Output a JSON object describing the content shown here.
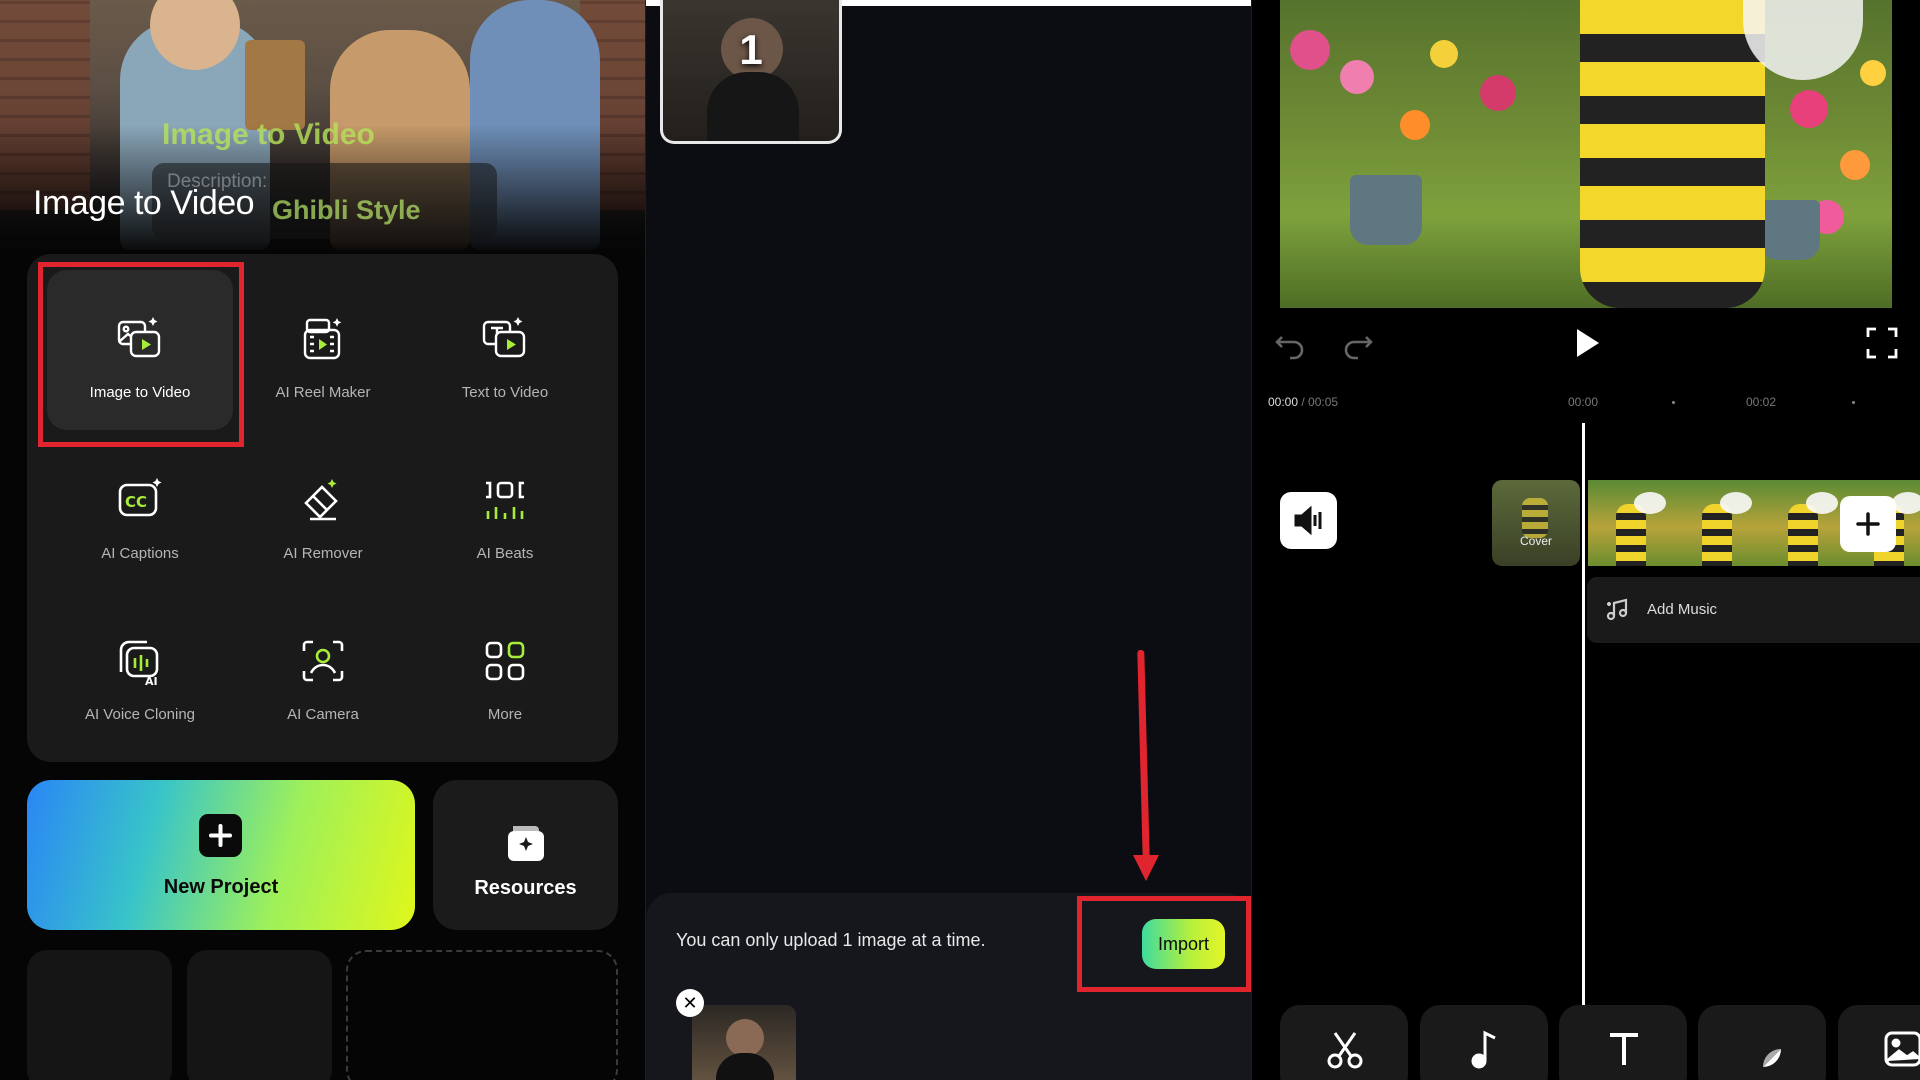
{
  "panel1": {
    "hero": {
      "overlay_title": "Image to Video",
      "overlay_description_label": "Description:",
      "overlay_style": "Ghibli Style",
      "title": "Image to Video"
    },
    "tools": [
      {
        "label": "Image to Video",
        "icon": "image-to-video-icon"
      },
      {
        "label": "AI Reel Maker",
        "icon": "reel-maker-icon"
      },
      {
        "label": "Text to Video",
        "icon": "text-to-video-icon"
      },
      {
        "label": "AI Captions",
        "icon": "captions-icon"
      },
      {
        "label": "AI Remover",
        "icon": "eraser-icon"
      },
      {
        "label": "AI Beats",
        "icon": "beats-icon"
      },
      {
        "label": "AI Voice Cloning",
        "icon": "voice-cloning-icon"
      },
      {
        "label": "AI Camera",
        "icon": "camera-person-icon"
      },
      {
        "label": "More",
        "icon": "grid-icon"
      }
    ],
    "new_project_label": "New Project",
    "resources_label": "Resources"
  },
  "panel2": {
    "thumb_number": "1",
    "upload_notice": "You can only upload 1 image at a time.",
    "import_label": "Import",
    "close_glyph": "✕"
  },
  "panel3": {
    "time_current": "00:00",
    "time_total": " / 00:05",
    "tick_0": "00:00",
    "tick_1": "00:02",
    "cover_label": "Cover",
    "add_music_label": "Add Music",
    "bottom_tools": [
      "cut-icon",
      "music-icon",
      "text-icon",
      "sticker-icon",
      "image-icon"
    ]
  },
  "colors": {
    "highlight_red": "#e0252f",
    "accent_green": "#b8f03a",
    "panel_dark": "#1a1a1a"
  }
}
